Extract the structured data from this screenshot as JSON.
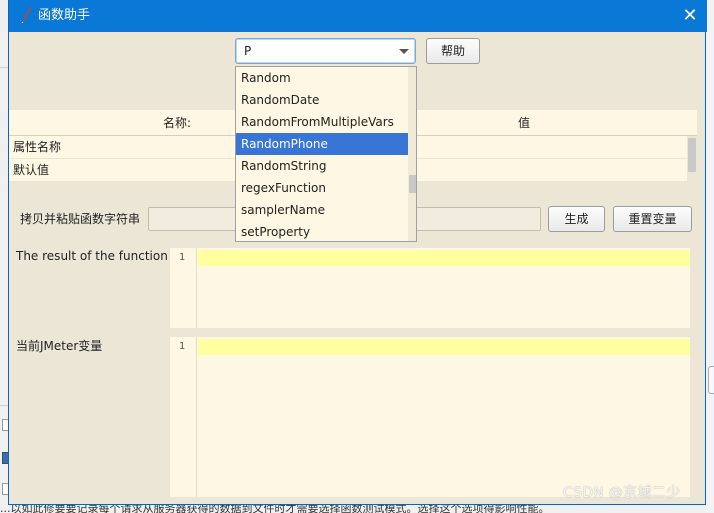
{
  "window": {
    "title": "函数助手",
    "close_glyph": "✕"
  },
  "function_selector": {
    "value": "P",
    "help_button": "帮助",
    "options": [
      "Random",
      "RandomDate",
      "RandomFromMultipleVars",
      "RandomPhone",
      "RandomString",
      "regexFunction",
      "samplerName",
      "setProperty"
    ],
    "highlighted_option": "RandomPhone"
  },
  "parameters_table": {
    "column_name": "名称:",
    "column_value": "值",
    "rows": [
      "属性名称",
      "默认值"
    ]
  },
  "function_string": {
    "label": "拷贝并粘贴函数字符串",
    "value": "",
    "generate_button": "生成",
    "reset_button": "重置变量"
  },
  "result_panel": {
    "label": "The result of the function is",
    "line_number": "1"
  },
  "variables_panel": {
    "label": "当前JMeter变量",
    "line_number": "1"
  },
  "watermark": "CSDN @京城二少",
  "background_text": "...以如此修要要记录每个请求从服务器获得的数据到文件时才需要选择函数测试模式。选择这个选项得影响性能。",
  "colors": {
    "titlebar": "#0a78d7",
    "dialog_bg": "#ece6d6",
    "panel_bg": "#fdf7e4",
    "highlight_line": "#ffff9f",
    "selection": "#3875d7"
  }
}
